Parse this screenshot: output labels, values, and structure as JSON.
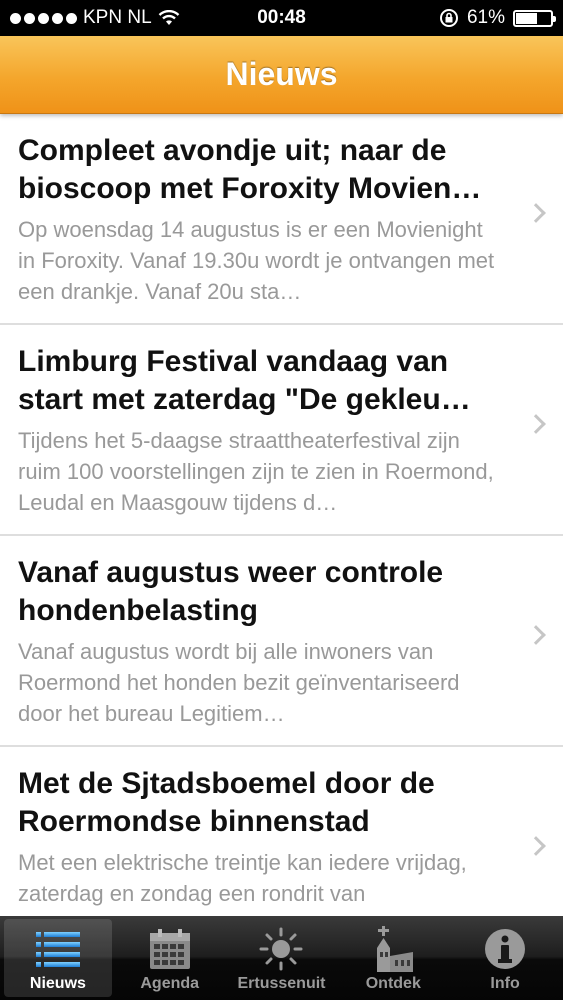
{
  "status_bar": {
    "carrier": "KPN NL",
    "time": "00:48",
    "battery_percent": "61%",
    "battery_level": 0.61
  },
  "nav": {
    "title": "Nieuws"
  },
  "news": [
    {
      "title": "Compleet avondje uit; naar de bioscoop met Foroxity Movien…",
      "summary": "Op woensdag 14 augustus is er een Movienight in Foroxity. Vanaf 19.30u wordt je ontvangen met een drankje. Vanaf 20u sta…"
    },
    {
      "title": "Limburg Festival vandaag van start met zaterdag \"De gekleu…",
      "summary": "Tijdens het 5-daagse straattheaterfestival zijn ruim 100 voorstellingen zijn te zien in Roermond, Leudal en Maasgouw tijdens d…"
    },
    {
      "title": "Vanaf augustus weer controle hondenbelasting",
      "summary": "Vanaf augustus wordt bij alle inwoners van Roermond het honden bezit geïnventariseerd door het bureau Legitiem…"
    },
    {
      "title": "Met de Sjtadsboemel door de Roermondse binnenstad",
      "summary": "Met een elektrische treintje kan iedere vrijdag, zaterdag en zondag een rondrit van"
    }
  ],
  "tabs": [
    {
      "label": "Nieuws",
      "icon": "list-icon",
      "active": true
    },
    {
      "label": "Agenda",
      "icon": "calendar-icon",
      "active": false
    },
    {
      "label": "Ertussenuit",
      "icon": "sun-icon",
      "active": false
    },
    {
      "label": "Ontdek",
      "icon": "church-icon",
      "active": false
    },
    {
      "label": "Info",
      "icon": "info-icon",
      "active": false
    }
  ],
  "colors": {
    "nav_orange": "#f4a62c",
    "tab_active_blue": "#3aa0e6"
  }
}
